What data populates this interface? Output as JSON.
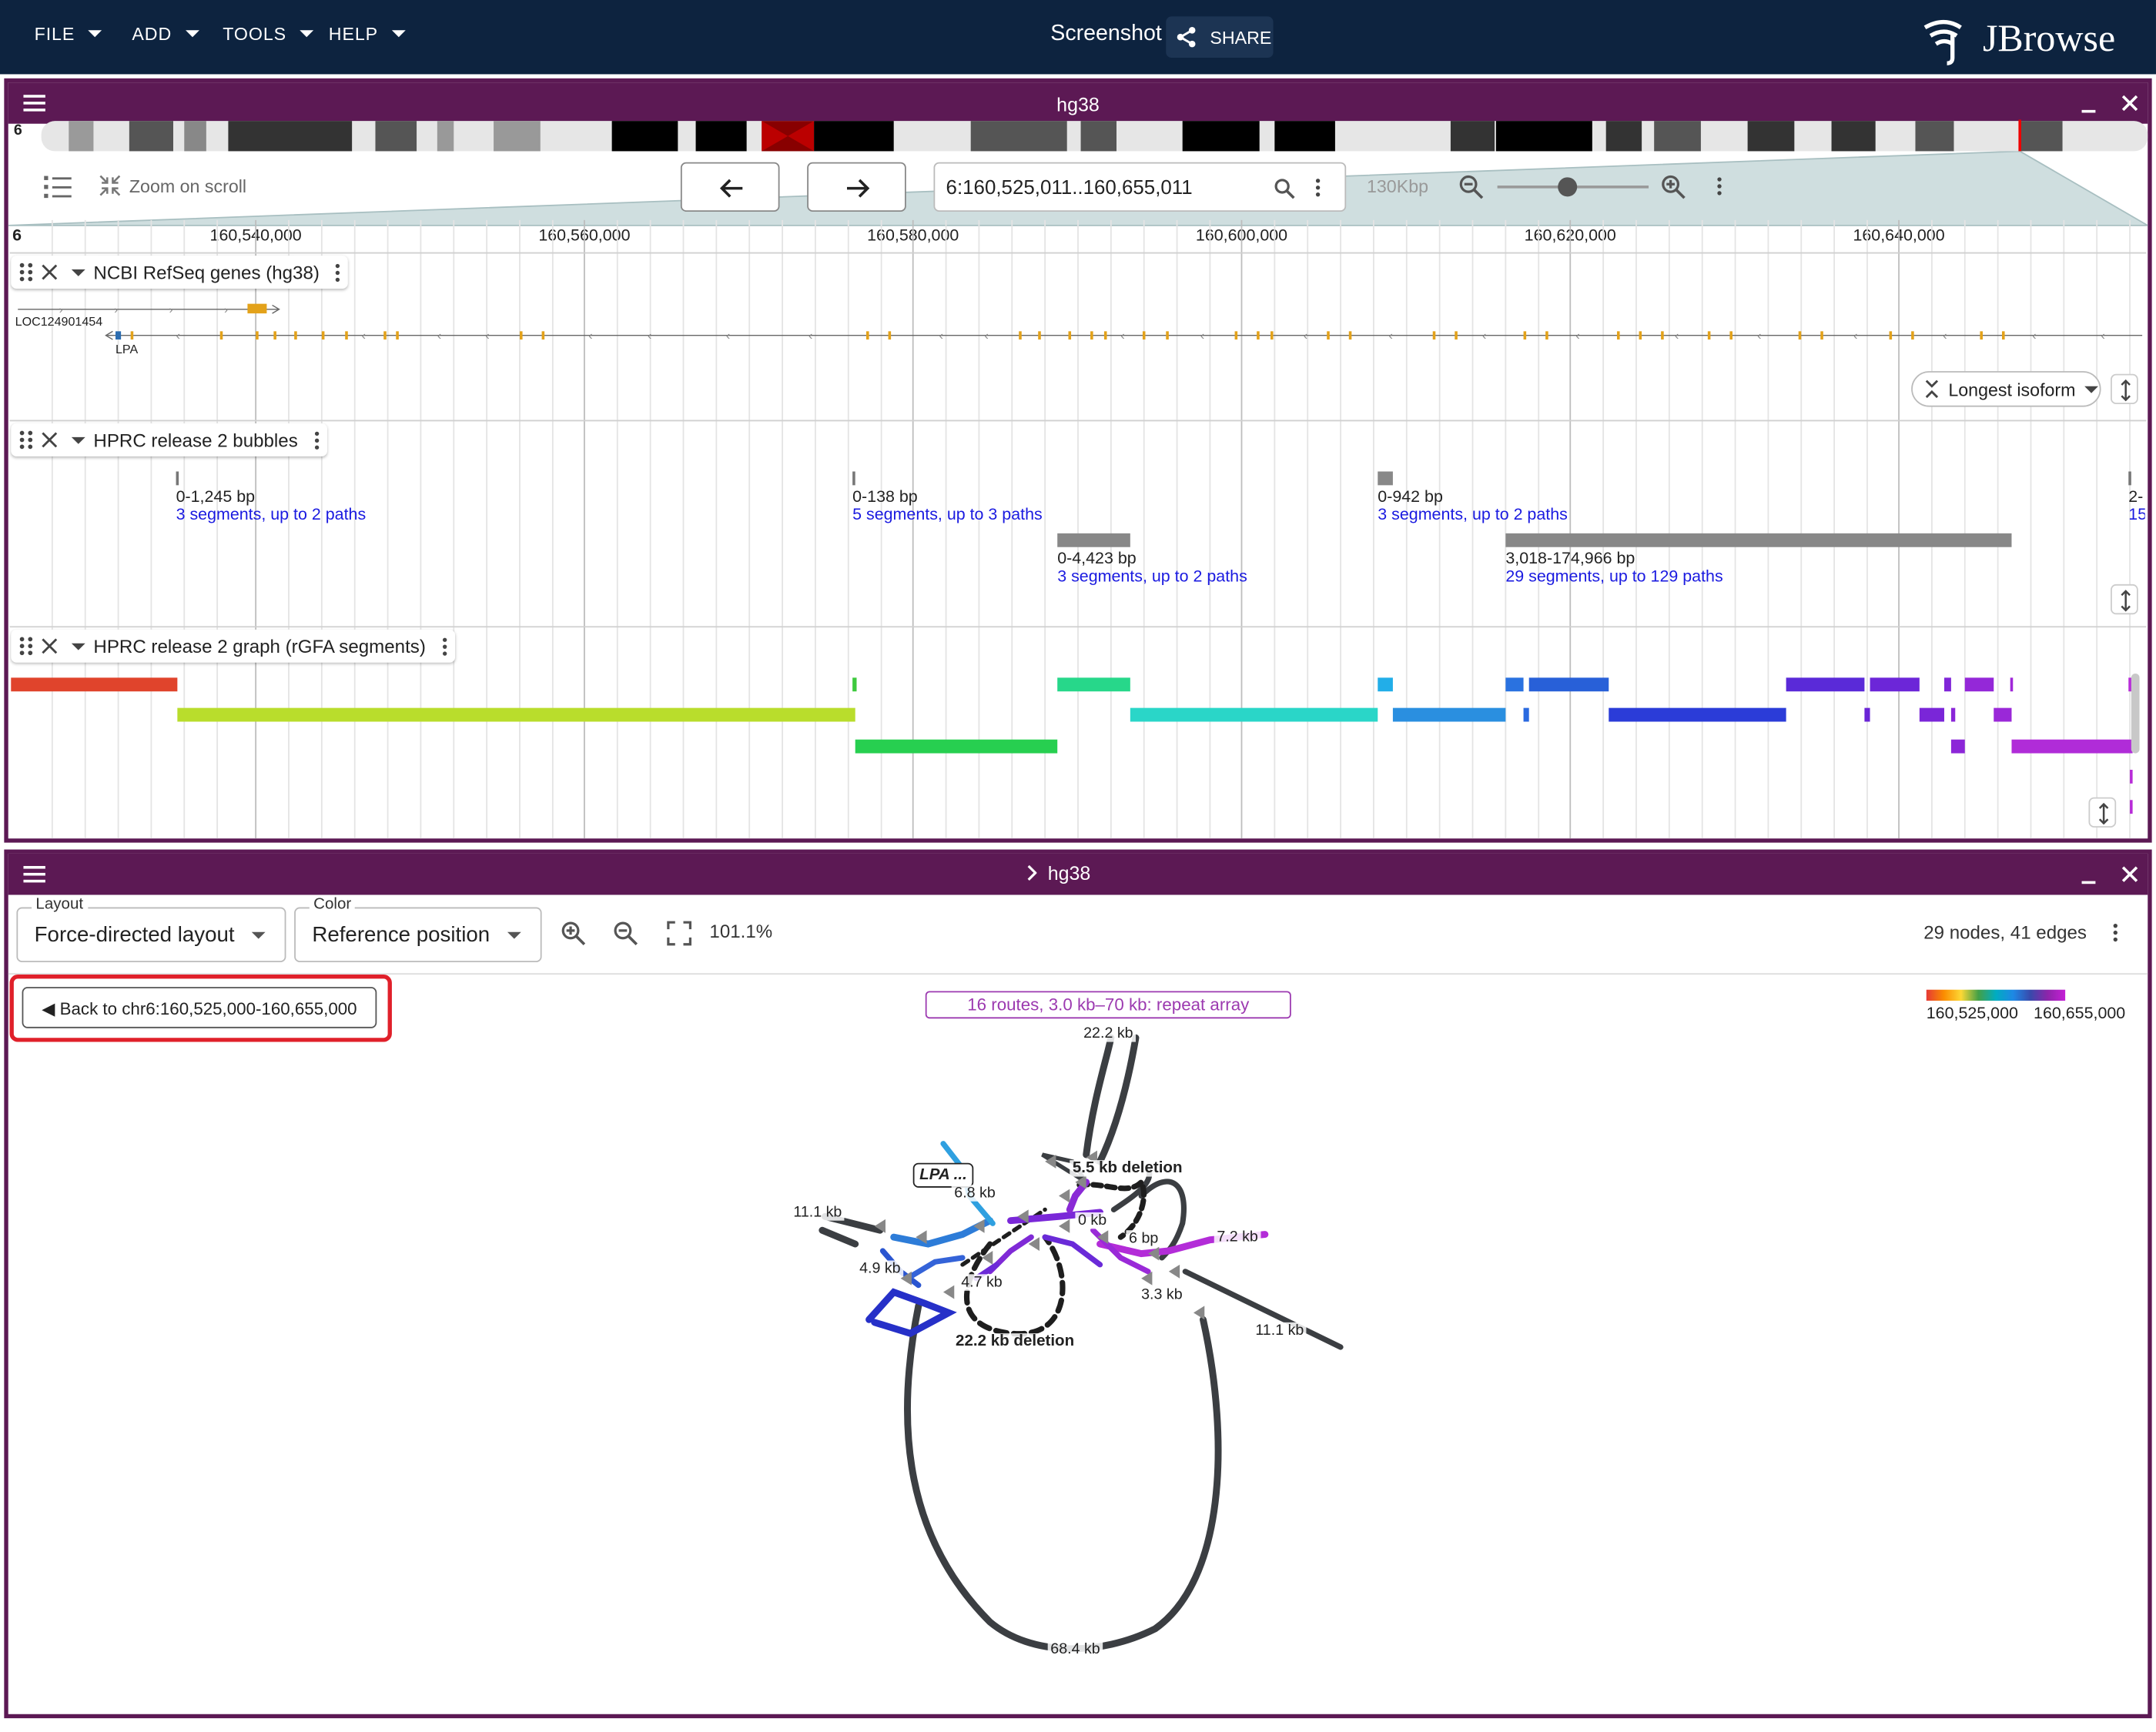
{
  "appbar": {
    "menus": [
      "FILE",
      "ADD",
      "TOOLS",
      "HELP"
    ],
    "title": "Screenshot",
    "share_label": "SHARE",
    "logo_text": "JBrowse"
  },
  "view1": {
    "title": "hg38",
    "chromosome": "6",
    "zoom_on_scroll_label": "Zoom on scroll",
    "locstring": "6:160,525,011..160,655,011",
    "bp_label": "130Kbp",
    "ruler_chrom": "6",
    "ruler_ticks": [
      "160,540,000",
      "160,560,000",
      "160,580,000",
      "160,600,000",
      "160,620,000",
      "160,640,000"
    ],
    "tracks": {
      "genes": {
        "name": "NCBI RefSeq genes (hg38)",
        "gene1": "LOC124901454",
        "gene2": "LPA",
        "isoform_label": "Longest isoform"
      },
      "bubbles": {
        "name": "HPRC release 2 bubbles",
        "items": [
          {
            "size": "0-1,245 bp",
            "desc": "3 segments, up to 2 paths"
          },
          {
            "size": "0-138 bp",
            "desc": "5 segments, up to 3 paths"
          },
          {
            "size": "0-4,423 bp",
            "desc": "3 segments, up to 2 paths"
          },
          {
            "size": "0-942 bp",
            "desc": "3 segments, up to 2 paths"
          },
          {
            "size": "3,018-174,966 bp",
            "desc": "29 segments, up to 129 paths"
          },
          {
            "size": "2-",
            "desc": "15"
          }
        ]
      },
      "graph": {
        "name": "HPRC release 2 graph (rGFA segments)"
      }
    }
  },
  "view2": {
    "title": "hg38",
    "layout_legend": "Layout",
    "layout_value": "Force-directed layout",
    "color_legend": "Color",
    "color_value": "Reference position",
    "zoom_pct": "101.1%",
    "stats": "29 nodes, 41 edges",
    "back_button": "◀ Back to chr6:160,525,000-160,655,000",
    "route_banner": "16 routes, 3.0 kb–70 kb: repeat array",
    "colorbar_min": "160,525,000",
    "colorbar_max": "160,655,000",
    "colorbar_colors": [
      "#e53935",
      "#fb8c00",
      "#fdd835",
      "#43a047",
      "#00acc1",
      "#1e88e5",
      "#3949ab",
      "#8e24aa",
      "#c51fd6"
    ],
    "graph_labels": {
      "l1": "22.2 kb",
      "l2": "5.5 kb deletion",
      "l3": "LPA ...",
      "l4": "6.8 kb",
      "l5": "11.1 kb",
      "l6": "0 kb",
      "l7": "6 bp",
      "l8": "7.2 kb",
      "l9": "4.9 kb",
      "l10": "4.7 kb",
      "l11": "3.3 kb",
      "l12": "11.1 kb",
      "l13": "22.2 kb deletion",
      "l14": "68.4 kb"
    }
  }
}
